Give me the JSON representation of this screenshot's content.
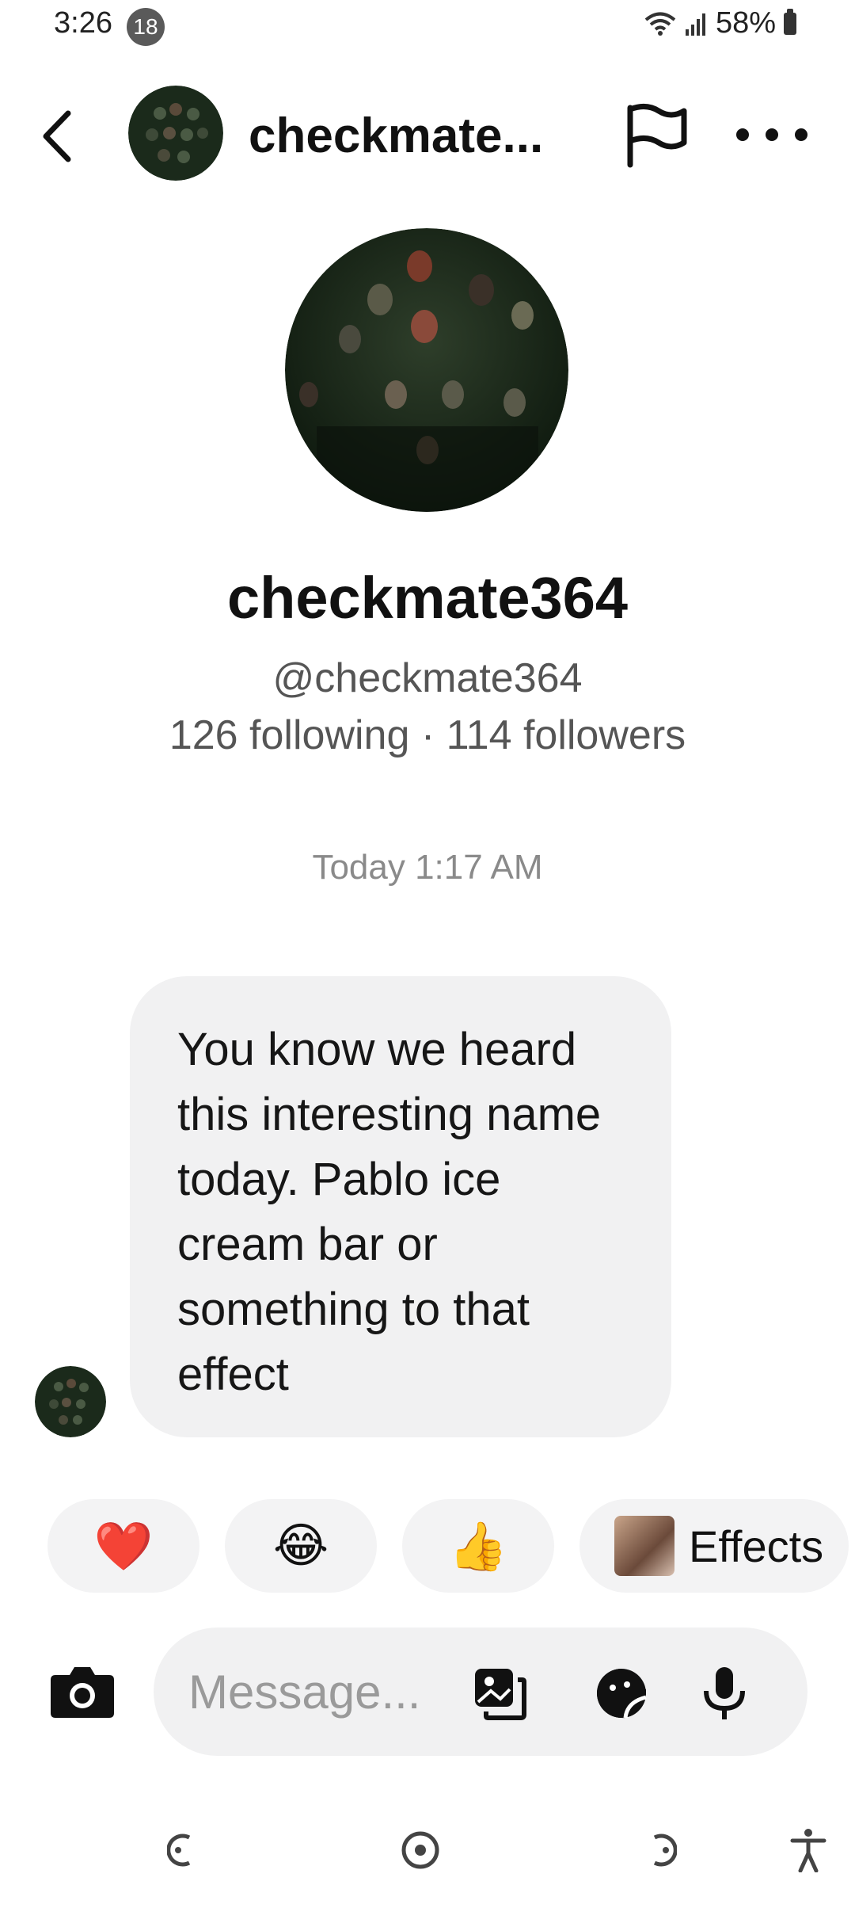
{
  "status_bar": {
    "time": "3:26",
    "notification_count": "18",
    "battery": "58%"
  },
  "header": {
    "username": "checkmate..."
  },
  "profile": {
    "display_name": "checkmate364",
    "handle": "@checkmate364",
    "stats": "126 following · 114 followers"
  },
  "conversation": {
    "timestamp": "Today 1:17 AM",
    "messages": [
      {
        "text": "You know we heard this interesting name today. Pablo ice cream bar or something to that effect"
      }
    ]
  },
  "reactions": [
    {
      "emoji": "❤️",
      "name": "heart"
    },
    {
      "emoji": "😂",
      "name": "laughing"
    },
    {
      "emoji": "👍",
      "name": "thumbs-up"
    }
  ],
  "effects_label": "Effects",
  "composer": {
    "placeholder": "Message..."
  },
  "colors": {
    "bubble": "#f1f1f2",
    "pill": "#f3f3f4",
    "muted_text": "#8a8a8a"
  }
}
